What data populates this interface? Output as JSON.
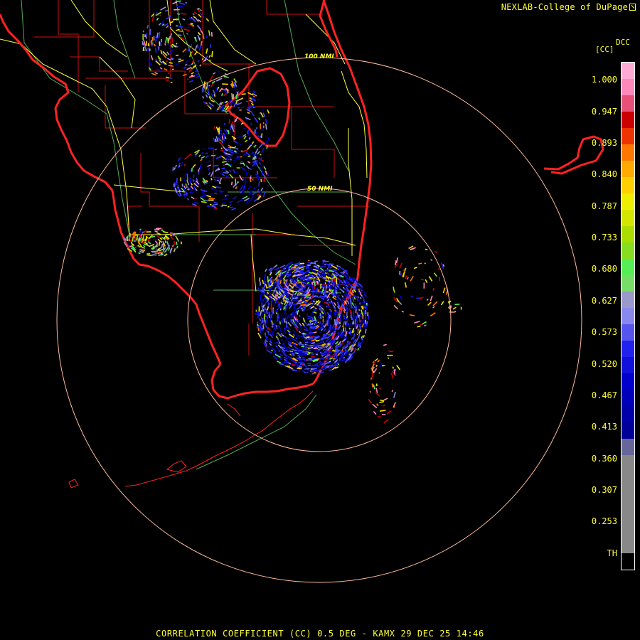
{
  "header": {
    "credit": "NEXLAB-College of DuPage"
  },
  "footer": {
    "caption": "CORRELATION COEFFICIENT (CC) 0.5 DEG - KAMX 29 DEC 25 14:46"
  },
  "legend": {
    "title": "DCC",
    "unit": "[CC]",
    "labels": [
      "1.000",
      "0.947",
      "0.893",
      "0.840",
      "0.787",
      "0.733",
      "0.680",
      "0.627",
      "0.573",
      "0.520",
      "0.467",
      "0.413",
      "0.360",
      "0.307",
      "0.253",
      "TH"
    ],
    "colors": [
      "#ffaad4",
      "#ff88bb",
      "#e8507a",
      "#cc0000",
      "#ee3300",
      "#ff7700",
      "#ffaa00",
      "#ffd000",
      "#eeee00",
      "#d4e600",
      "#aadd00",
      "#88dd22",
      "#55ee55",
      "#77dd66",
      "#9999cc",
      "#8888ee",
      "#5555ee",
      "#2222ee",
      "#1111dd",
      "#0000cc",
      "#0000bb",
      "#0000aa",
      "#000099",
      "#666699",
      "#888888",
      "#888888",
      "#888888",
      "#888888",
      "#888888",
      "#888888",
      "#000000"
    ]
  },
  "map": {
    "ring_labels": [
      "50 NMI",
      "100 NMI"
    ],
    "colors": {
      "coastline": "#ff2222",
      "county_lines": "#cc1111",
      "state_roads": "#ffff44",
      "highways": "#55aa55",
      "range_rings": "#ffbb99"
    },
    "radar_site": "KAMX"
  }
}
